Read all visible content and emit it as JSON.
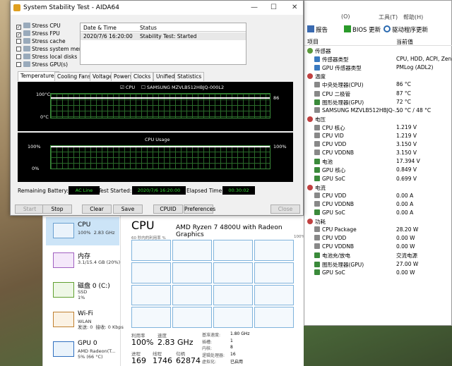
{
  "aida": {
    "title": "System Stability Test - AIDA64",
    "stress": [
      {
        "label": "Stress CPU",
        "checked": true
      },
      {
        "label": "Stress FPU",
        "checked": true
      },
      {
        "label": "Stress cache",
        "checked": false
      },
      {
        "label": "Stress system memory",
        "checked": false
      },
      {
        "label": "Stress local disks",
        "checked": false
      },
      {
        "label": "Stress GPU(s)",
        "checked": false
      }
    ],
    "status_header": {
      "col1": "Date & Time",
      "col2": "Status"
    },
    "status_row": {
      "time": "2020/7/6 16:20:00",
      "status": "Stability Test: Started"
    },
    "tabs": [
      "Temperatures",
      "Cooling Fans",
      "Voltages",
      "Powers",
      "Clocks",
      "Unified",
      "Statistics"
    ],
    "temp_graph": {
      "legend_cpu": "CPU",
      "legend_disk": "SAMSUNG MZVLB512HBJQ-000L2",
      "y_top": "100°C",
      "y_bottom": "0°C",
      "value": "86",
      "level": 0.86
    },
    "usage_graph": {
      "title": "CPU Usage",
      "y_top": "100%",
      "y_bottom": "0%",
      "value": "100%",
      "level": 1.0
    },
    "battery_label": "Remaining Battery:",
    "battery_value": "AC Line",
    "started_label": "Test Started:",
    "started_value": "2020/7/6 16:20:00",
    "elapsed_label": "Elapsed Time:",
    "elapsed_value": "00:30:02",
    "buttons": {
      "start": "Start",
      "stop": "Stop",
      "clear": "Clear",
      "save": "Save",
      "cpuid": "CPUID",
      "prefs": "Preferences",
      "close": "Close"
    }
  },
  "hw": {
    "menu": [
      "(O)",
      "工具(T)",
      "帮助(H)"
    ],
    "toolbar": {
      "report": "报告",
      "bios": "BIOS 更新",
      "driver": "驱动程序更新"
    },
    "col_item": "项目",
    "col_value": "当前值",
    "rows": [
      {
        "type": "group",
        "name": "传感器",
        "color": "#5a9a3a"
      },
      {
        "type": "item",
        "name": "传感器类型",
        "value": "CPU, HDD, ACPI, Zen",
        "color": "#3a7ac0"
      },
      {
        "type": "item",
        "name": "GPU 传感器类型",
        "value": "PMLog  (ADL2)",
        "color": "#3a7ac0"
      },
      {
        "type": "group",
        "name": "温度",
        "color": "#c04040"
      },
      {
        "type": "item",
        "name": "中央处理器(CPU)",
        "value": "86 °C",
        "color": "#888"
      },
      {
        "type": "item",
        "name": "CPU 二极管",
        "value": "87 °C",
        "color": "#888"
      },
      {
        "type": "item",
        "name": "图形处理器(GPU)",
        "value": "72 °C",
        "color": "#3a8a3a"
      },
      {
        "type": "item",
        "name": "SAMSUNG MZVLB512HBJQ-...",
        "value": "50 °C / 48 °C",
        "color": "#888"
      },
      {
        "type": "group",
        "name": "电压",
        "color": "#c04040"
      },
      {
        "type": "item",
        "name": "CPU 核心",
        "value": "1.219 V",
        "color": "#888"
      },
      {
        "type": "item",
        "name": "CPU VID",
        "value": "1.219 V",
        "color": "#888"
      },
      {
        "type": "item",
        "name": "CPU VDD",
        "value": "3.150 V",
        "color": "#888"
      },
      {
        "type": "item",
        "name": "CPU VDDNB",
        "value": "3.150 V",
        "color": "#888"
      },
      {
        "type": "item",
        "name": "电池",
        "value": "17.394 V",
        "color": "#3a8a3a"
      },
      {
        "type": "item",
        "name": "GPU 核心",
        "value": "0.849 V",
        "color": "#3a8a3a"
      },
      {
        "type": "item",
        "name": "GPU SoC",
        "value": "0.699 V",
        "color": "#3a8a3a"
      },
      {
        "type": "group",
        "name": "电流",
        "color": "#c04040"
      },
      {
        "type": "item",
        "name": "CPU VDD",
        "value": "0.00 A",
        "color": "#888"
      },
      {
        "type": "item",
        "name": "CPU VDDNB",
        "value": "0.00 A",
        "color": "#888"
      },
      {
        "type": "item",
        "name": "GPU SoC",
        "value": "0.00 A",
        "color": "#3a8a3a"
      },
      {
        "type": "group",
        "name": "功耗",
        "color": "#c04040"
      },
      {
        "type": "item",
        "name": "CPU Package",
        "value": "28.20 W",
        "color": "#888"
      },
      {
        "type": "item",
        "name": "CPU VDD",
        "value": "0.00 W",
        "color": "#888"
      },
      {
        "type": "item",
        "name": "CPU VDDNB",
        "value": "0.00 W",
        "color": "#888"
      },
      {
        "type": "item",
        "name": "电池充/放电",
        "value": "交流电源",
        "color": "#3a8a3a"
      },
      {
        "type": "item",
        "name": "图形处理器(GPU)",
        "value": "27.00 W",
        "color": "#3a8a3a"
      },
      {
        "type": "item",
        "name": "GPU SoC",
        "value": "0.00 W",
        "color": "#3a8a3a"
      }
    ]
  },
  "tm": {
    "items": [
      {
        "name": "CPU",
        "sub": "100%  2.83 GHz",
        "kind": ""
      },
      {
        "name": "内存",
        "sub": "3.1/15.4 GB (20%)",
        "kind": "mem"
      },
      {
        "name": "磁盘 0 (C:)",
        "sub": "SSD\n1%",
        "kind": "disk"
      },
      {
        "name": "Wi-Fi",
        "sub": "WLAN\n发送: 0  接收: 0 Kbps",
        "kind": "net"
      },
      {
        "name": "GPU 0",
        "sub": "AMD Radeon(T...\n5% (66 °C)",
        "kind": "gpu"
      }
    ],
    "title": "CPU",
    "model": "AMD Ryzen 7 4800U with Radeon Graphics",
    "graph_label": "60 秒内的利用率 %",
    "graph_pct": "100%",
    "util_label": "利用率",
    "util": "100%",
    "speed_label": "速度",
    "speed": "2.83 GHz",
    "proc_label": "进程",
    "proc": "169",
    "thread_label": "线程",
    "thread": "1746",
    "handle_label": "句柄",
    "handle": "62874",
    "kv": [
      {
        "k": "基准速度:",
        "v": "1.80 GHz"
      },
      {
        "k": "插槽:",
        "v": "1"
      },
      {
        "k": "内核:",
        "v": "8"
      },
      {
        "k": "逻辑处理器:",
        "v": "16"
      },
      {
        "k": "虚拟化:",
        "v": "已启用"
      }
    ]
  }
}
